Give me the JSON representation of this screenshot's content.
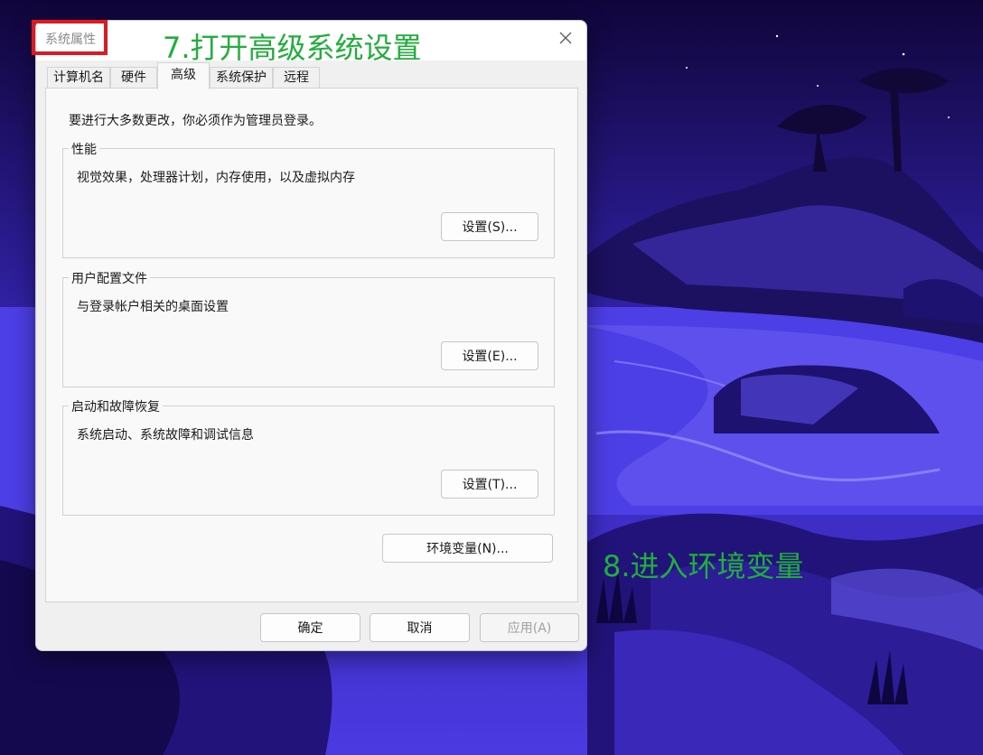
{
  "dialog": {
    "title": "系统属性",
    "tabs": [
      {
        "label": "计算机名",
        "active": false
      },
      {
        "label": "硬件",
        "active": false
      },
      {
        "label": "高级",
        "active": true
      },
      {
        "label": "系统保护",
        "active": false
      },
      {
        "label": "远程",
        "active": false
      }
    ],
    "admin_note": "要进行大多数更改，你必须作为管理员登录。",
    "groups": [
      {
        "legend": "性能",
        "description": "视觉效果，处理器计划，内存使用，以及虚拟内存",
        "button": "设置(S)..."
      },
      {
        "legend": "用户配置文件",
        "description": "与登录帐户相关的桌面设置",
        "button": "设置(E)..."
      },
      {
        "legend": "启动和故障恢复",
        "description": "系统启动、系统故障和调试信息",
        "button": "设置(T)..."
      }
    ],
    "env_button": "环境变量(N)...",
    "footer": {
      "ok": "确定",
      "cancel": "取消",
      "apply": "应用(A)"
    }
  },
  "annotations": {
    "step7": "7.打开高级系统设置",
    "step8": "8.进入环境变量",
    "highlight_color": "#e3171f",
    "text_color": "#1fb03a"
  },
  "icons": {
    "close": "close-icon",
    "arrow": "right-arrow-icon"
  }
}
